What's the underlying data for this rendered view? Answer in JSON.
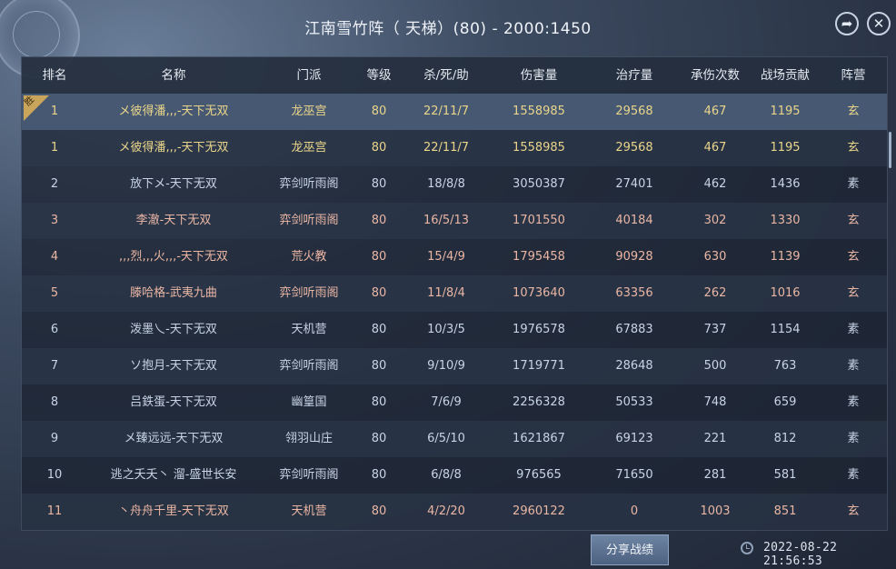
{
  "title": "江南雪竹阵（ 天梯）(80) - 2000:1450",
  "win_badge": "胜",
  "headers": [
    "排名",
    "名称",
    "门派",
    "等级",
    "杀/死/助",
    "伤害量",
    "治疗量",
    "承伤次数",
    "战场贡献",
    "阵营"
  ],
  "rows": [
    {
      "rank": "1",
      "name": "メ彼得潘,,,-天下无双",
      "school": "龙巫宫",
      "level": "80",
      "kda": "22/11/7",
      "damage": "1558985",
      "heal": "29568",
      "taken": "467",
      "contrib": "1195",
      "camp": "玄"
    },
    {
      "rank": "1",
      "name": "メ彼得潘,,,-天下无双",
      "school": "龙巫宫",
      "level": "80",
      "kda": "22/11/7",
      "damage": "1558985",
      "heal": "29568",
      "taken": "467",
      "contrib": "1195",
      "camp": "玄"
    },
    {
      "rank": "2",
      "name": "放下メ-天下无双",
      "school": "弈剑听雨阁",
      "level": "80",
      "kda": "18/8/8",
      "damage": "3050387",
      "heal": "27401",
      "taken": "462",
      "contrib": "1436",
      "camp": "素"
    },
    {
      "rank": "3",
      "name": "李澈-天下无双",
      "school": "弈剑听雨阁",
      "level": "80",
      "kda": "16/5/13",
      "damage": "1701550",
      "heal": "40184",
      "taken": "302",
      "contrib": "1330",
      "camp": "玄"
    },
    {
      "rank": "4",
      "name": ",,,烈,,,火,,,-天下无双",
      "school": "荒火教",
      "level": "80",
      "kda": "15/4/9",
      "damage": "1795458",
      "heal": "90928",
      "taken": "630",
      "contrib": "1139",
      "camp": "玄"
    },
    {
      "rank": "5",
      "name": "滕哈格-武夷九曲",
      "school": "弈剑听雨阁",
      "level": "80",
      "kda": "11/8/4",
      "damage": "1073640",
      "heal": "63356",
      "taken": "262",
      "contrib": "1016",
      "camp": "玄"
    },
    {
      "rank": "6",
      "name": "泼墨乀-天下无双",
      "school": "天机营",
      "level": "80",
      "kda": "10/3/5",
      "damage": "1976578",
      "heal": "67883",
      "taken": "737",
      "contrib": "1154",
      "camp": "素"
    },
    {
      "rank": "7",
      "name": "ソ抱月-天下无双",
      "school": "弈剑听雨阁",
      "level": "80",
      "kda": "9/10/9",
      "damage": "1719771",
      "heal": "28648",
      "taken": "500",
      "contrib": "763",
      "camp": "素"
    },
    {
      "rank": "8",
      "name": "吕鉄蛋-天下无双",
      "school": "幽篁国",
      "level": "80",
      "kda": "7/6/9",
      "damage": "2256328",
      "heal": "50533",
      "taken": "748",
      "contrib": "659",
      "camp": "素"
    },
    {
      "rank": "9",
      "name": "メ臻远远-天下无双",
      "school": "翎羽山庄",
      "level": "80",
      "kda": "6/5/10",
      "damage": "1621867",
      "heal": "69123",
      "taken": "221",
      "contrib": "812",
      "camp": "素"
    },
    {
      "rank": "10",
      "name": "逃之夭夭丶 溜-盛世长安",
      "school": "弈剑听雨阁",
      "level": "80",
      "kda": "6/8/8",
      "damage": "976565",
      "heal": "71650",
      "taken": "281",
      "contrib": "581",
      "camp": "素"
    },
    {
      "rank": "11",
      "name": "丶舟舟千里-天下无双",
      "school": "天机营",
      "level": "80",
      "kda": "4/2/20",
      "damage": "2960122",
      "heal": "0",
      "taken": "1003",
      "contrib": "851",
      "camp": "玄"
    }
  ],
  "share_button": "分享战绩",
  "timestamp": "2022-08-22 21:56:53",
  "icons": {
    "share": "share-arrow-icon",
    "close": "close-icon",
    "clock": "clock-icon"
  },
  "colors": {
    "highlight_row": "#465872",
    "own_row_text": "#ead58a",
    "xuan_text": "#eab6a4",
    "su_text": "#c7d4e6"
  }
}
